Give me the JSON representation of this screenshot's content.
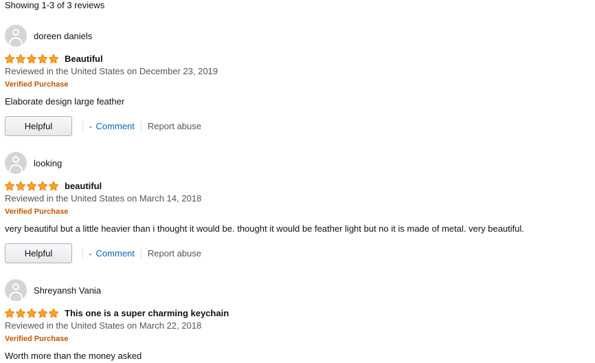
{
  "summary": "Showing 1-3 of 3 reviews",
  "colors": {
    "star": "#ffa41c",
    "star_stroke": "#e47911",
    "verified": "#c45500",
    "link": "#0066c0"
  },
  "reviews": [
    {
      "author": "doreen daniels",
      "rating": 5,
      "title": "Beautiful",
      "date": "Reviewed in the United States on December 23, 2019",
      "verified": "Verified Purchase",
      "body": "Elaborate design large feather",
      "helpful_label": "Helpful",
      "comment_label": "Comment",
      "report_label": "Report abuse"
    },
    {
      "author": "looking",
      "rating": 5,
      "title": "beautiful",
      "date": "Reviewed in the United States on March 14, 2018",
      "verified": "Verified Purchase",
      "body": "very beautiful but a little heavier than i thought it would be. thought it would be feather light but no it is made of metal. very beautiful.",
      "helpful_label": "Helpful",
      "comment_label": "Comment",
      "report_label": "Report abuse"
    },
    {
      "author": "Shreyansh Vania",
      "rating": 5,
      "title": "This one is a super charming keychain",
      "date": "Reviewed in the United States on March 22, 2018",
      "verified": "Verified Purchase",
      "body": "Worth more than the money asked"
    }
  ]
}
